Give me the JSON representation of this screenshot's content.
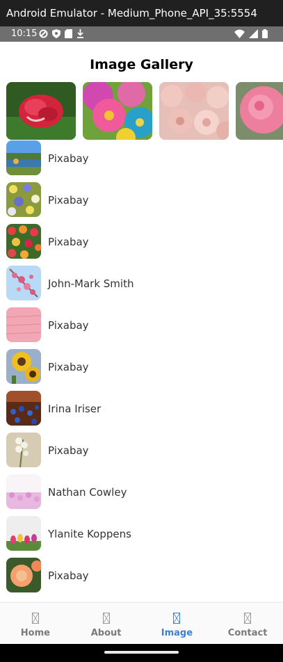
{
  "window": {
    "title": "Android Emulator - Medium_Phone_API_35:5554"
  },
  "status_bar": {
    "time": "10:15",
    "left_icons": [
      "data-saver-icon",
      "shield-icon",
      "sim-card-icon",
      "download-icon"
    ],
    "right_icons": [
      "wifi-icon",
      "signal-icon",
      "battery-icon"
    ]
  },
  "app": {
    "title": "Image Gallery"
  },
  "carousel": {
    "items": [
      {
        "subject": "red rose"
      },
      {
        "subject": "colorful gerbera daisies"
      },
      {
        "subject": "pink ranunculus"
      },
      {
        "subject": "pink rose"
      }
    ]
  },
  "gallery": {
    "items": [
      {
        "author": "Pixabay",
        "subject": "lake landscape"
      },
      {
        "author": "Pixabay",
        "subject": "wildflowers"
      },
      {
        "author": "Pixabay",
        "subject": "tulips field"
      },
      {
        "author": "John-Mark Smith",
        "subject": "pink blossoms"
      },
      {
        "author": "Pixabay",
        "subject": "pink wood"
      },
      {
        "author": "Pixabay",
        "subject": "sunflowers"
      },
      {
        "author": "Irina Iriser",
        "subject": "blue flowers"
      },
      {
        "author": "Pixabay",
        "subject": "white flowers"
      },
      {
        "author": "Nathan Cowley",
        "subject": "pink field"
      },
      {
        "author": "Ylanite Koppens",
        "subject": "tulips"
      },
      {
        "author": "Pixabay",
        "subject": "orange roses"
      }
    ]
  },
  "tabs": [
    {
      "label": "Home",
      "active": false
    },
    {
      "label": "About",
      "active": false
    },
    {
      "label": "Image",
      "active": true
    },
    {
      "label": "Contact",
      "active": false
    }
  ],
  "colors": {
    "accent": "#3f7fd0",
    "inactive_tab": "#7a7a7a",
    "status_bar": "#6f6f6f",
    "title_bar": "#202020"
  }
}
